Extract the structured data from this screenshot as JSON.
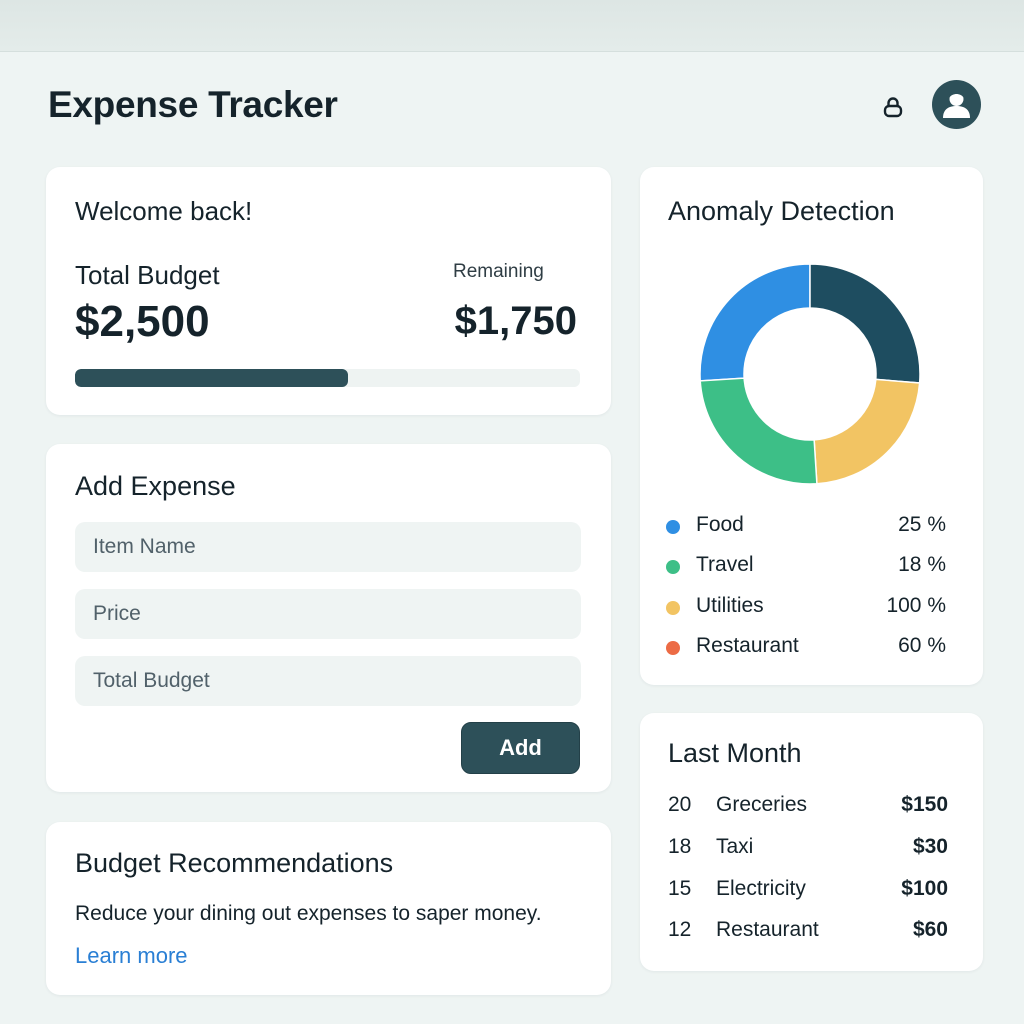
{
  "header": {
    "title": "Expense Tracker",
    "icons": {
      "lock": "lock-icon",
      "avatar": "user-avatar-icon"
    }
  },
  "welcome": {
    "greeting": "Welcome back!",
    "total_budget_label": "Total Budget",
    "total_budget_value": "$2,500",
    "remaining_label": "Remaining",
    "remaining_value": "$1,750",
    "progress_fraction": 0.54
  },
  "add_expense": {
    "title": "Add Expense",
    "fields": [
      {
        "placeholder": "Item Name",
        "value": ""
      },
      {
        "placeholder": "Price",
        "value": ""
      },
      {
        "placeholder": "Total Budget",
        "value": ""
      }
    ],
    "add_label": "Add"
  },
  "recommendations": {
    "title": "Budget Recommendations",
    "text": "Reduce your dining out expenses to saper money.",
    "link_label": "Learn more"
  },
  "anomaly": {
    "title": "Anomaly Detection",
    "legend": [
      {
        "name": "Food",
        "pct": "25 %",
        "color": "#2f8fe3"
      },
      {
        "name": "Travel",
        "pct": "18 %",
        "color": "#3dbf87"
      },
      {
        "name": "Utilities",
        "pct": "100 %",
        "color": "#f2c463"
      },
      {
        "name": "Restaurant",
        "pct": "60 %",
        "color": "#ec6b45"
      }
    ],
    "donut_segments": [
      {
        "label": "Food",
        "fraction": 0.26,
        "color": "#2f8fe3"
      },
      {
        "label": "Navy",
        "fraction": 0.263,
        "color": "#1e4d60"
      },
      {
        "label": "Utilities",
        "fraction": 0.227,
        "color": "#f2c463"
      },
      {
        "label": "Travel",
        "fraction": 0.25,
        "color": "#3dbf87"
      }
    ]
  },
  "last_month": {
    "title": "Last Month",
    "rows": [
      {
        "day": "20",
        "name": "Greceries",
        "amount": "$150"
      },
      {
        "day": "18",
        "name": "Taxi",
        "amount": "$30"
      },
      {
        "day": "15",
        "name": "Electricity",
        "amount": "$100"
      },
      {
        "day": "12",
        "name": "Restaurant",
        "amount": "$60"
      }
    ]
  },
  "colors": {
    "accent": "#2d5059",
    "background": "#eef4f3",
    "link": "#2a7fd4"
  }
}
